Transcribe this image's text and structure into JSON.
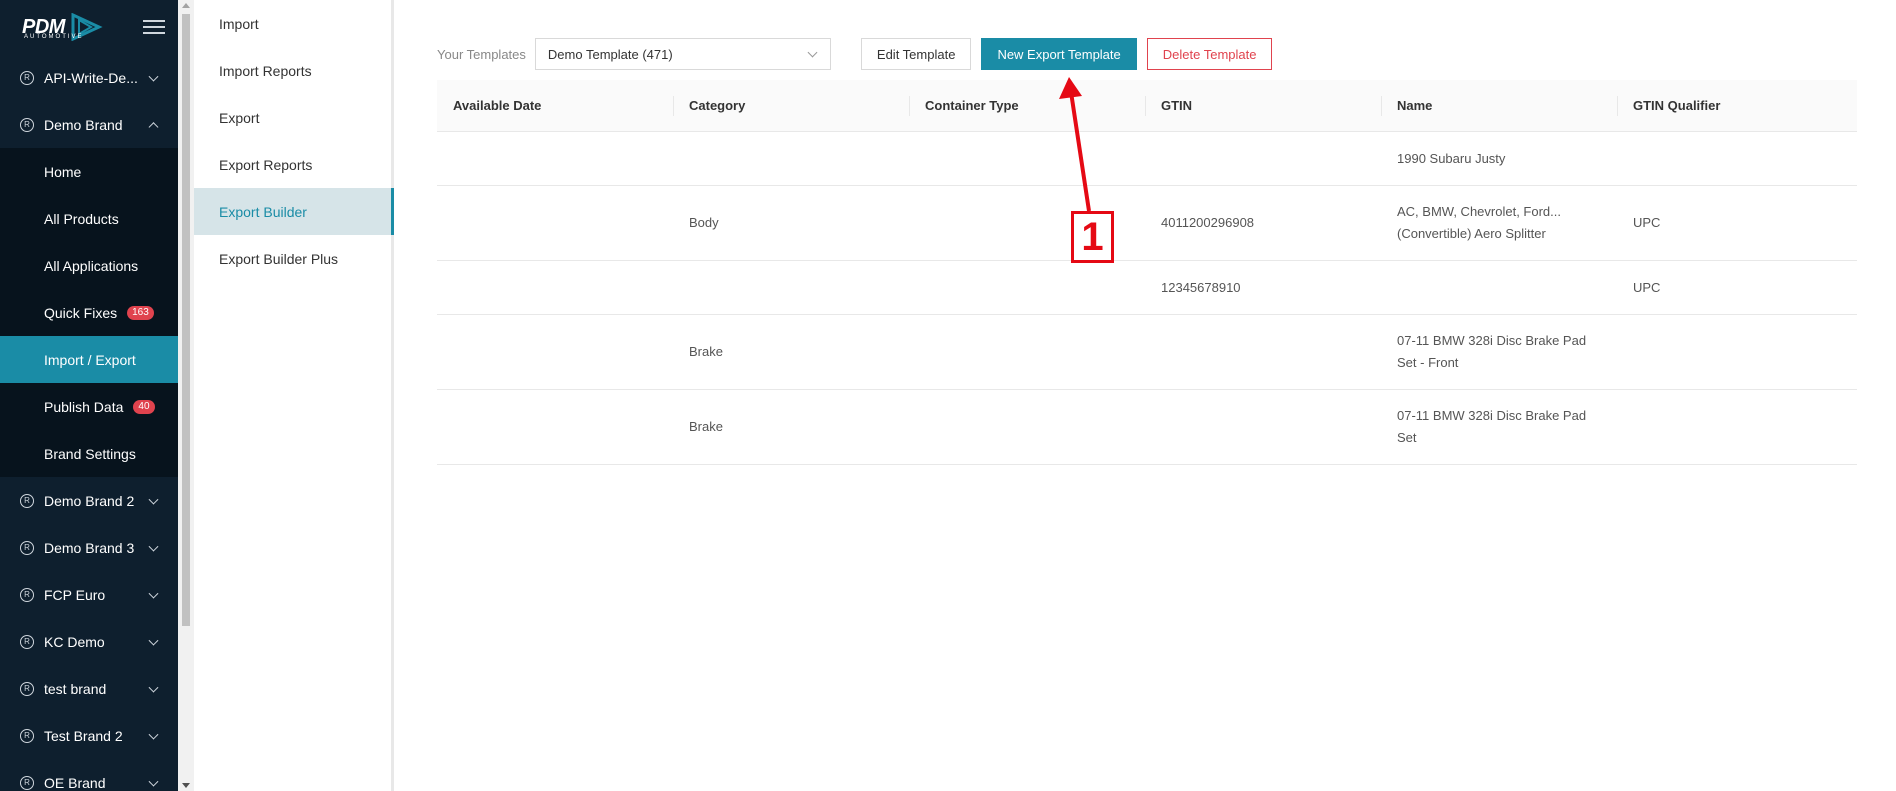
{
  "app": {
    "logo_text": "PDM",
    "logo_sub": "AUTOMOTIVE",
    "brand_color": "#1a8ca6"
  },
  "sidebar": {
    "brands": [
      {
        "label": "API-Write-De...",
        "expanded": false
      },
      {
        "label": "Demo Brand",
        "expanded": true
      },
      {
        "label": "Demo Brand 2",
        "expanded": false
      },
      {
        "label": "Demo Brand 3",
        "expanded": false
      },
      {
        "label": "FCP Euro",
        "expanded": false
      },
      {
        "label": "KC Demo",
        "expanded": false
      },
      {
        "label": "test brand",
        "expanded": false
      },
      {
        "label": "Test Brand 2",
        "expanded": false
      },
      {
        "label": "OE Brand",
        "expanded": false
      }
    ],
    "submenu": [
      {
        "label": "Home"
      },
      {
        "label": "All Products"
      },
      {
        "label": "All Applications"
      },
      {
        "label": "Quick Fixes",
        "badge": "163"
      },
      {
        "label": "Import / Export",
        "active": true
      },
      {
        "label": "Publish Data",
        "badge": "40"
      },
      {
        "label": "Brand Settings"
      }
    ]
  },
  "subnav": {
    "items": [
      {
        "label": "Import"
      },
      {
        "label": "Import Reports"
      },
      {
        "label": "Export"
      },
      {
        "label": "Export Reports"
      },
      {
        "label": "Export Builder",
        "active": true
      },
      {
        "label": "Export Builder Plus"
      }
    ]
  },
  "toolbar": {
    "templates_label": "Your Templates",
    "selected_template": "Demo Template (471)",
    "edit_label": "Edit Template",
    "new_label": "New Export Template",
    "delete_label": "Delete Template"
  },
  "table": {
    "columns": [
      "Available Date",
      "Category",
      "Container Type",
      "GTIN",
      "Name",
      "GTIN Qualifier"
    ],
    "rows": [
      [
        "",
        "",
        "",
        "",
        "1990 Subaru Justy",
        ""
      ],
      [
        "",
        "Body",
        "",
        "4011200296908",
        "AC, BMW, Chevrolet, Ford... (Convertible) Aero Splitter",
        "UPC"
      ],
      [
        "",
        "",
        "",
        "12345678910",
        "",
        "UPC"
      ],
      [
        "",
        "Brake",
        "",
        "",
        "07-11 BMW 328i Disc Brake Pad Set  - Front",
        ""
      ],
      [
        "",
        "Brake",
        "",
        "",
        "07-11 BMW 328i Disc Brake Pad Set",
        ""
      ]
    ]
  },
  "annotation": {
    "number": "1",
    "color": "#e50914"
  }
}
